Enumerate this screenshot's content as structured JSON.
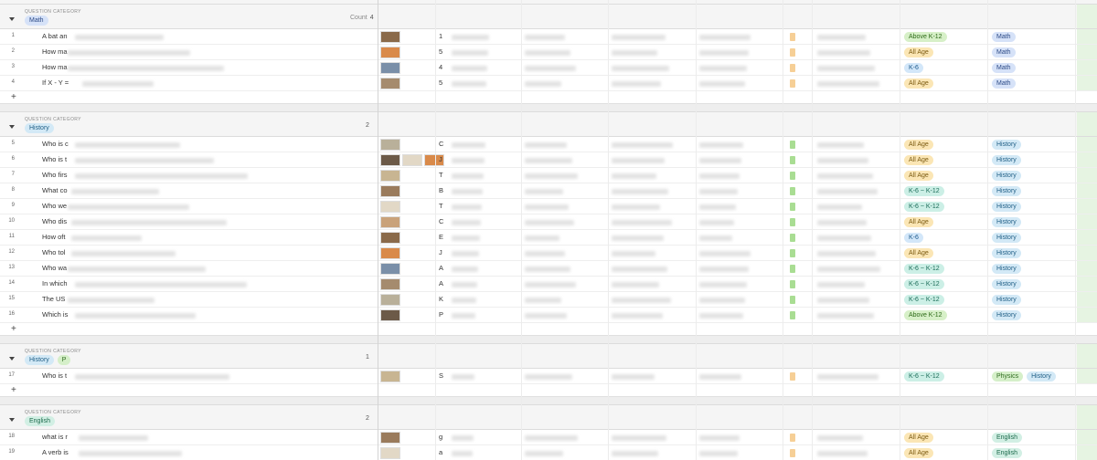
{
  "category_label": "QUESTION CATEGORY",
  "count_label": "Count",
  "add_icon": "plus-icon",
  "groups": [
    {
      "chips": [
        {
          "label": "Math",
          "style": "math"
        }
      ],
      "count": "4",
      "rows": [
        {
          "num": "1",
          "q": "A bat an",
          "ans": "1",
          "age": "Above K-12",
          "age_style": "above",
          "mark": "orange",
          "cats": [
            {
              "label": "Math",
              "style": "math"
            }
          ]
        },
        {
          "num": "2",
          "q": "How ma",
          "ans": "5",
          "age": "All Age",
          "age_style": "allage",
          "mark": "orange",
          "cats": [
            {
              "label": "Math",
              "style": "math"
            }
          ]
        },
        {
          "num": "3",
          "q": "How ma",
          "ans": "4",
          "age": "K-6",
          "age_style": "k6",
          "mark": "orange",
          "cats": [
            {
              "label": "Math",
              "style": "math"
            }
          ]
        },
        {
          "num": "4",
          "q": "If X - Y =",
          "ans": "5",
          "age": "All Age",
          "age_style": "allage",
          "mark": "orange",
          "cats": [
            {
              "label": "Math",
              "style": "math"
            }
          ]
        }
      ]
    },
    {
      "chips": [
        {
          "label": "History",
          "style": "history"
        }
      ],
      "count": "2",
      "rows": [
        {
          "num": "5",
          "q": "Who is c",
          "ans": "C",
          "age": "All Age",
          "age_style": "allage",
          "mark": "green",
          "cats": [
            {
              "label": "History",
              "style": "history"
            }
          ]
        },
        {
          "num": "6",
          "q": "Who is t",
          "ans": "J",
          "age": "All Age",
          "age_style": "allage",
          "mark": "green",
          "cats": [
            {
              "label": "History",
              "style": "history"
            }
          ]
        },
        {
          "num": "7",
          "q": "Who firs",
          "ans": "T",
          "age": "All Age",
          "age_style": "allage",
          "mark": "green",
          "cats": [
            {
              "label": "History",
              "style": "history"
            }
          ]
        },
        {
          "num": "8",
          "q": "What co",
          "ans": "B",
          "age": "K-6 ~ K-12",
          "age_style": "k6k12",
          "mark": "green",
          "cats": [
            {
              "label": "History",
              "style": "history"
            }
          ]
        },
        {
          "num": "9",
          "q": "Who we",
          "ans": "T",
          "age": "K-6 ~ K-12",
          "age_style": "k6k12",
          "mark": "green",
          "cats": [
            {
              "label": "History",
              "style": "history"
            }
          ]
        },
        {
          "num": "10",
          "q": "Who dis",
          "ans": "C",
          "age": "All Age",
          "age_style": "allage",
          "mark": "green",
          "cats": [
            {
              "label": "History",
              "style": "history"
            }
          ]
        },
        {
          "num": "11",
          "q": "How oft",
          "ans": "E",
          "age": "K-6",
          "age_style": "k6",
          "mark": "green",
          "cats": [
            {
              "label": "History",
              "style": "history"
            }
          ]
        },
        {
          "num": "12",
          "q": "Who tol",
          "ans": "J",
          "age": "All Age",
          "age_style": "allage",
          "mark": "green",
          "cats": [
            {
              "label": "History",
              "style": "history"
            }
          ]
        },
        {
          "num": "13",
          "q": "Who wa",
          "ans": "A",
          "age": "K-6 ~ K-12",
          "age_style": "k6k12",
          "mark": "green",
          "cats": [
            {
              "label": "History",
              "style": "history"
            }
          ]
        },
        {
          "num": "14",
          "q": "In which",
          "ans": "A",
          "age": "K-6 ~ K-12",
          "age_style": "k6k12",
          "mark": "green",
          "cats": [
            {
              "label": "History",
              "style": "history"
            }
          ]
        },
        {
          "num": "15",
          "q": "The US",
          "ans": "K",
          "age": "K-6 ~ K-12",
          "age_style": "k6k12",
          "mark": "green",
          "cats": [
            {
              "label": "History",
              "style": "history"
            }
          ]
        },
        {
          "num": "16",
          "q": "Which is",
          "ans": "P",
          "age": "Above K-12",
          "age_style": "above",
          "mark": "green",
          "cats": [
            {
              "label": "History",
              "style": "history"
            }
          ]
        }
      ]
    },
    {
      "chips": [
        {
          "label": "History",
          "style": "history"
        },
        {
          "label": "P",
          "style": "physics"
        }
      ],
      "count": "1",
      "rows": [
        {
          "num": "17",
          "q": "Who is t",
          "ans": "S",
          "age": "K-6 ~ K-12",
          "age_style": "k6k12",
          "mark": "orange",
          "cats": [
            {
              "label": "Physics",
              "style": "physics"
            },
            {
              "label": "History",
              "style": "history"
            }
          ]
        }
      ]
    },
    {
      "chips": [
        {
          "label": "English",
          "style": "english"
        }
      ],
      "count": "2",
      "rows": [
        {
          "num": "18",
          "q": "what is r",
          "ans": "g",
          "age": "All Age",
          "age_style": "allage",
          "mark": "orange",
          "cats": [
            {
              "label": "English",
              "style": "english"
            }
          ]
        },
        {
          "num": "19",
          "q": "A verb is",
          "ans": "a",
          "age": "All Age",
          "age_style": "allage",
          "mark": "orange",
          "cats": [
            {
              "label": "English",
              "style": "english"
            }
          ]
        }
      ]
    }
  ]
}
